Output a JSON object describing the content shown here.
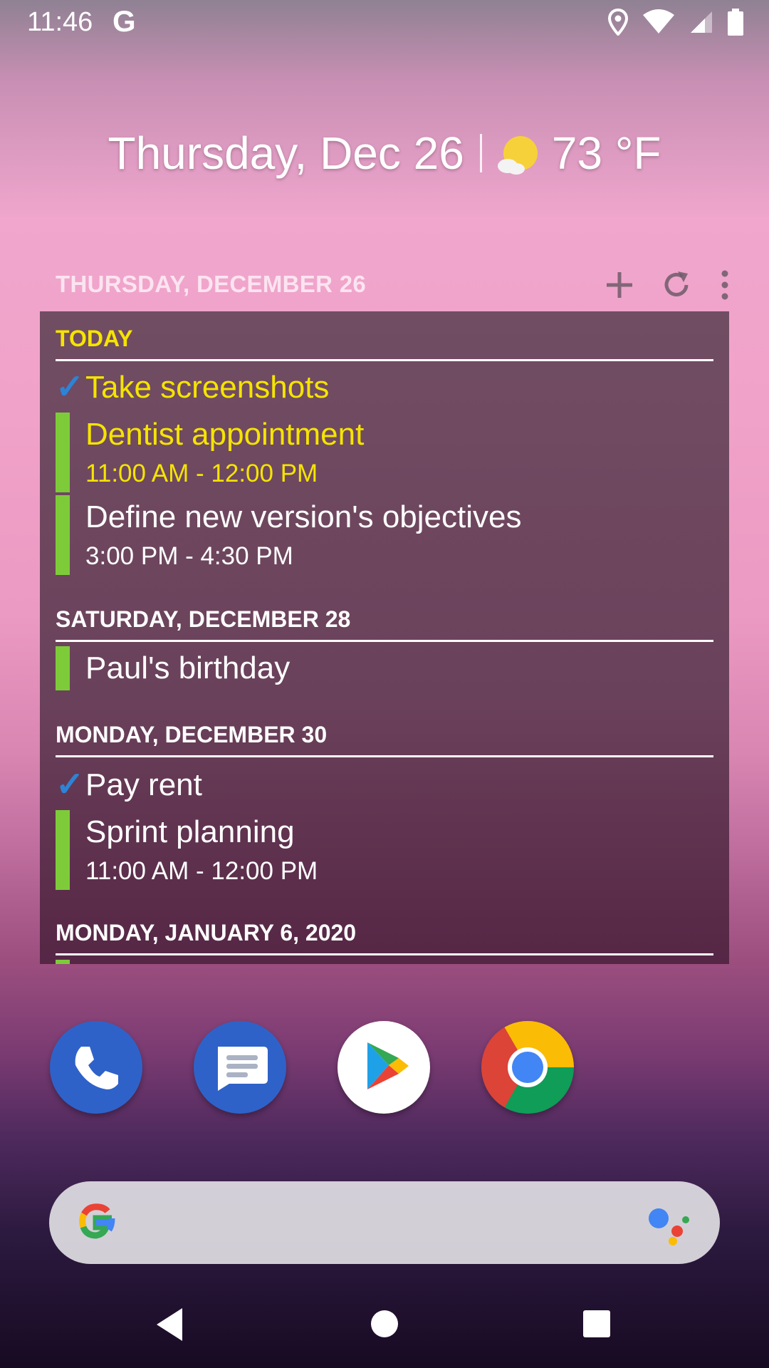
{
  "status": {
    "time": "11:46",
    "g_label": "G"
  },
  "glance": {
    "date": "Thursday, Dec 26",
    "temperature": "73 °F"
  },
  "widget": {
    "header_date": "THURSDAY, DECEMBER 26",
    "days": [
      {
        "heading": "TODAY",
        "items": [
          {
            "type": "task",
            "title": "Take screenshots"
          },
          {
            "type": "event",
            "title": "Dentist appointment",
            "time": "11:00 AM - 12:00 PM"
          },
          {
            "type": "event",
            "title": "Define new version's objectives",
            "time": "3:00 PM - 4:30 PM"
          }
        ]
      },
      {
        "heading": "SATURDAY, DECEMBER 28",
        "items": [
          {
            "type": "event",
            "title": "Paul's birthday"
          }
        ]
      },
      {
        "heading": "MONDAY, DECEMBER 30",
        "items": [
          {
            "type": "task",
            "title": "Pay rent"
          },
          {
            "type": "event",
            "title": "Sprint planning",
            "time": "11:00 AM - 12:00 PM"
          }
        ]
      },
      {
        "heading": "MONDAY, JANUARY 6, 2020",
        "items": []
      }
    ]
  },
  "dock": [
    "phone-icon",
    "messages-icon",
    "play-store-icon",
    "chrome-icon"
  ],
  "search": {
    "logo": "google-g-icon",
    "assistant": "assistant-icon"
  },
  "colors": {
    "today_accent": "#f5e400",
    "event_bar": "#7ecb3a",
    "task_check": "#2d83d6"
  }
}
